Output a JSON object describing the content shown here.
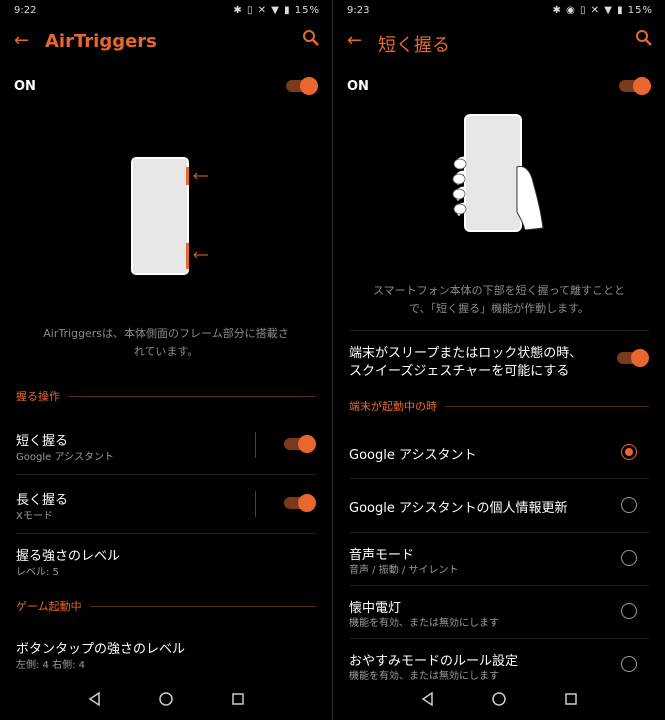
{
  "left": {
    "status": {
      "time": "9:22",
      "icons": "✱ ▯ ✕ ▼ ▮ 15%"
    },
    "title": "AirTriggers",
    "on_label": "ON",
    "caption_line1": "AirTriggersは、本体側面のフレーム部分に搭載さ",
    "caption_line2": "れています。",
    "section1": "握る操作",
    "items": [
      {
        "title": "短く握る",
        "subtitle": "Google アシスタント"
      },
      {
        "title": "長く握る",
        "subtitle": "Xモード"
      },
      {
        "title": "握る強さのレベル",
        "subtitle": "レベル: 5"
      }
    ],
    "section2": "ゲーム起動中",
    "tap_item": {
      "title": "ボタンタップの強さのレベル",
      "subtitle": "左側: 4 右側: 4"
    }
  },
  "right": {
    "status": {
      "time": "9:23",
      "icons": "✱ ◉ ▯ ✕ ▼ ▮ 15%"
    },
    "title": "短く握る",
    "on_label": "ON",
    "caption_line1": "スマートフォン本体の下部を短く握って離すことと",
    "caption_line2": "で、「短く握る」機能が作動します。",
    "sleep_line1": "端末がスリープまたはロック状態の時、",
    "sleep_line2": "スクイーズジェスチャーを可能にする",
    "section": "端末が起動中の時",
    "options": [
      {
        "title": "Google アシスタント",
        "subtitle": ""
      },
      {
        "title": "Google アシスタントの個人情報更新",
        "subtitle": ""
      },
      {
        "title": "音声モード",
        "subtitle": "音声 / 振動 / サイレント"
      },
      {
        "title": "懐中電灯",
        "subtitle": "機能を有効、または無効にします"
      },
      {
        "title": "おやすみモードのルール設定",
        "subtitle": "機能を有効、または無効にします"
      }
    ],
    "selected_option": "Google アシスタント"
  },
  "colors": {
    "accent": "#e8672f",
    "background": "#000000"
  }
}
